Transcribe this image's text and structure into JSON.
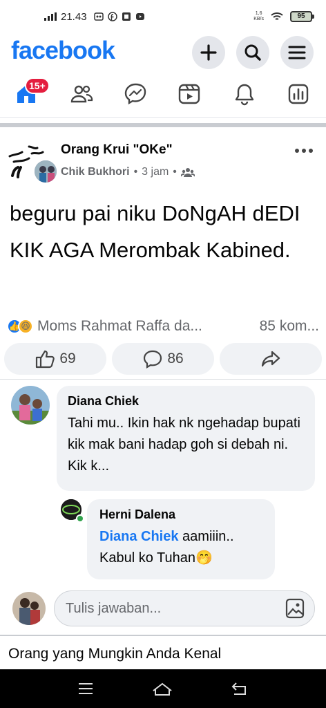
{
  "status": {
    "time": "21.43",
    "net_speed": "1,6",
    "net_unit": "KB/s",
    "battery": "95"
  },
  "header": {
    "logo": "facebook"
  },
  "nav": {
    "notif_badge": "15+"
  },
  "post": {
    "group": "Orang Krui \"OKe\"",
    "author": "Chik Bukhori",
    "time": "3 jam",
    "text": "beguru pai niku DoNgAH dEDI KIK AGA Merombak Kabined.",
    "reaction_names": "Moms Rahmat Raffa da...",
    "comment_count": "85 kom...",
    "like_count": "69",
    "comment_btn_count": "86"
  },
  "comments": [
    {
      "name": "Diana Chiek",
      "text": "Tahi mu.. Ikin hak nk ngehadap bupati kik mak bani hadap goh si debah ni. Kik k..."
    }
  ],
  "reply": {
    "name": "Herni Dalena",
    "mention": "Diana Chiek",
    "text1": " aamiiin..",
    "text2": "Kabul ko Tuhan",
    "emoji": "🤭"
  },
  "reply_input": {
    "placeholder": "Tulis jawaban..."
  },
  "suggest": "Orang yang Mungkin Anda Kenal"
}
